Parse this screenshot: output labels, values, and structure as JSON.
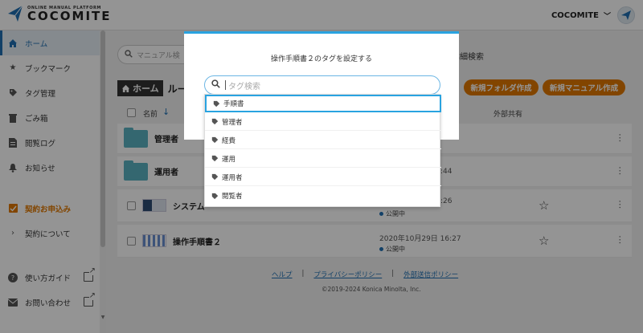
{
  "header": {
    "logo_sub": "ONLINE MANUAL PLATFORM",
    "logo_main": "COCOMITE",
    "user_label": "COCOMITE"
  },
  "sidebar": {
    "items": [
      {
        "label": "ホーム",
        "icon": "home-icon"
      },
      {
        "label": "ブックマーク",
        "icon": "star-icon"
      },
      {
        "label": "タグ管理",
        "icon": "tag-icon"
      },
      {
        "label": "ごみ箱",
        "icon": "trash-icon"
      },
      {
        "label": "閲覧ログ",
        "icon": "document-icon"
      },
      {
        "label": "お知らせ",
        "icon": "bell-icon"
      }
    ],
    "contract": {
      "label": "契約お申込み"
    },
    "about": {
      "label": "契約について"
    },
    "guide": {
      "label": "使い方ガイド"
    },
    "contact": {
      "label": "お問い合わせ"
    }
  },
  "main": {
    "search_placeholder": "マニュアル検",
    "detail_search": "詳細検索",
    "breadcrumb_home": "ホーム",
    "breadcrumb_root": "ルー",
    "new_folder_button": "新規フォルダ作成",
    "new_manual_button": "新規マニュアル作成",
    "columns": {
      "name": "名前",
      "external_share": "外部共有"
    },
    "rows": [
      {
        "type": "folder",
        "name": "管理者",
        "date": "",
        "status": ""
      },
      {
        "type": "folder",
        "name": "運用者",
        "date": ":44",
        "status": ""
      },
      {
        "type": "manual",
        "name": "システム操作マニュアル（一般）",
        "name_visible": "システム",
        "date": ":26",
        "status": "公開中"
      },
      {
        "type": "manual",
        "name": "操作手順書２",
        "date": "2020年10月29日 16:27",
        "status": "公開中"
      }
    ]
  },
  "footer": {
    "help": "ヘルプ",
    "privacy": "プライバシーポリシー",
    "external": "外部送信ポリシー",
    "separator": "|",
    "copyright": "©2019-2024 Konica Minolta, Inc."
  },
  "modal": {
    "title": "操作手順書２のタグを設定する",
    "search_placeholder": "タグ検索",
    "tags": [
      "手順書",
      "管理者",
      "経費",
      "運用",
      "運用者",
      "閲覧者"
    ],
    "selected_index": 0
  },
  "colors": {
    "accent_blue": "#1f6fb2",
    "modal_border": "#29a3e0",
    "orange": "#e07800",
    "folder": "#5bb1c2"
  }
}
